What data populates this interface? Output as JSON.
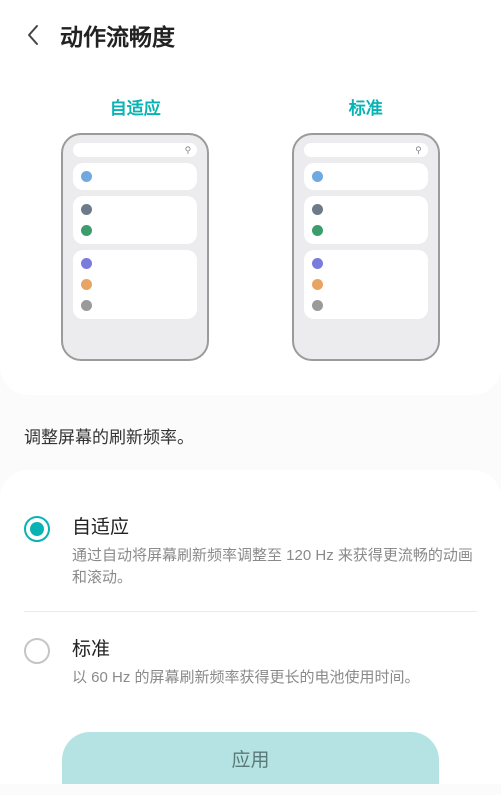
{
  "header": {
    "title": "动作流畅度"
  },
  "previews": {
    "adaptive_label": "自适应",
    "standard_label": "标准"
  },
  "subheading": "调整屏幕的刷新频率。",
  "options": {
    "adaptive": {
      "title": "自适应",
      "desc": "通过自动将屏幕刷新频率调整至 120 Hz 来获得更流畅的动画和滚动。"
    },
    "standard": {
      "title": "标准",
      "desc": "以 60 Hz 的屏幕刷新频率获得更长的电池使用时间。"
    }
  },
  "apply_label": "应用"
}
